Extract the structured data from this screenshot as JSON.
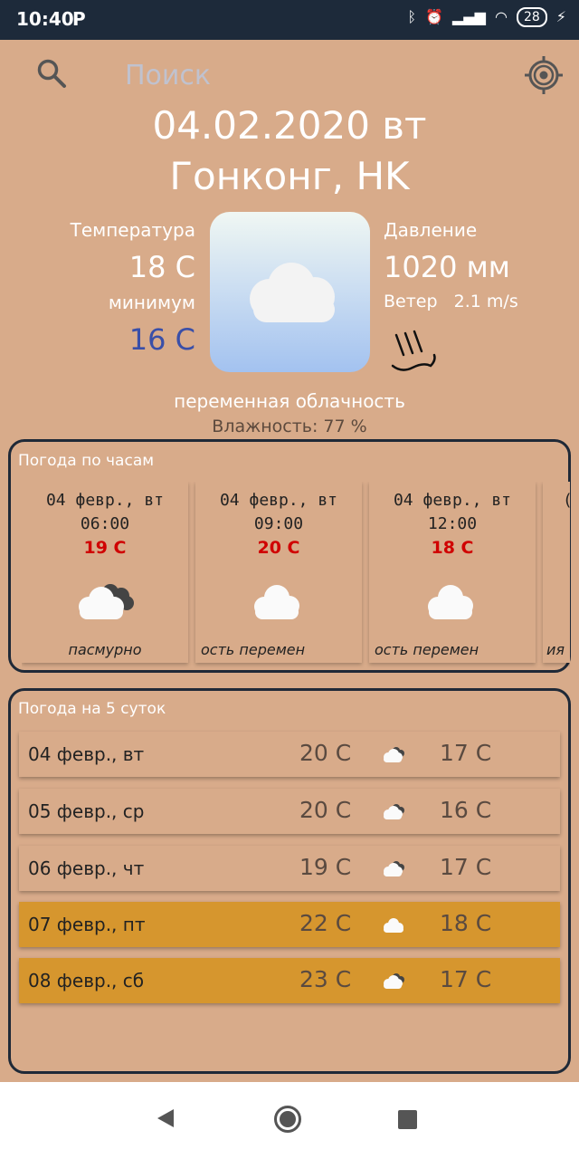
{
  "status_bar": {
    "time": "10:40",
    "p_icon": "P",
    "battery": "28"
  },
  "search": {
    "placeholder": "Поиск"
  },
  "header": {
    "date": "04.02.2020 вт",
    "city": "Гонконг, HK"
  },
  "current": {
    "temp_label": "Температура",
    "temp": "18 C",
    "min_label": "минимум",
    "min": "16 C",
    "pressure_label": "Давление",
    "pressure": "1020 мм",
    "wind_label": "Ветер",
    "wind": "2.1 m/s",
    "description": "переменная облачность",
    "humidity": "Влажность: 77 %"
  },
  "hourly": {
    "title": "Погода по часам",
    "cards": [
      {
        "date": "04 февр., вт",
        "time": "06:00",
        "temp": "19 C",
        "icon": "cloud-dark-icon",
        "desc": "пасмурно"
      },
      {
        "date": "04 февр., вт",
        "time": "09:00",
        "temp": "20 C",
        "icon": "cloud-icon",
        "desc": "ость        перемен"
      },
      {
        "date": "04 февр., вт",
        "time": "12:00",
        "temp": "18 C",
        "icon": "cloud-icon",
        "desc": "ость        перемен"
      },
      {
        "date": "(",
        "time": "",
        "temp": "",
        "icon": "",
        "desc": "ия"
      }
    ]
  },
  "daily": {
    "title": "Погода на 5 суток",
    "rows": [
      {
        "date": "04 февр., вт",
        "max": "20 C",
        "min": "17 C",
        "icon": "cloud-dark-icon",
        "highlighted": false
      },
      {
        "date": "05 февр., ср",
        "max": "20 C",
        "min": "16 C",
        "icon": "cloud-dark-icon",
        "highlighted": false
      },
      {
        "date": "06 февр., чт",
        "max": "19 C",
        "min": "17 C",
        "icon": "cloud-dark-icon",
        "highlighted": false
      },
      {
        "date": "07 февр., пт",
        "max": "22 C",
        "min": "18 C",
        "icon": "cloud-icon",
        "highlighted": true
      },
      {
        "date": "08 февр., сб",
        "max": "23 C",
        "min": "17 C",
        "icon": "cloud-dark-icon",
        "highlighted": true
      }
    ]
  },
  "colors": {
    "background": "#d8ab8a",
    "highlight_row": "#d6962e",
    "min_temp": "#3a4fa8",
    "hourly_temp": "#d00000"
  }
}
